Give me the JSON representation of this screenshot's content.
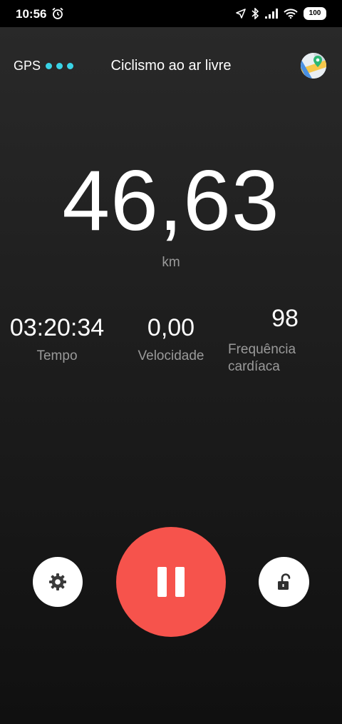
{
  "status_bar": {
    "time": "10:56",
    "battery": "100"
  },
  "header": {
    "gps_label": "GPS",
    "title": "Ciclismo ao ar livre"
  },
  "distance": {
    "value": "46,63",
    "unit": "km"
  },
  "stats": [
    {
      "value": "03:20:34",
      "label": "Tempo"
    },
    {
      "value": "0,00",
      "label": "Velocidade"
    },
    {
      "value": "98",
      "label": "Frequência cardíaca"
    }
  ],
  "colors": {
    "accent": "#39d3e6",
    "pause_button": "#f6534c",
    "muted_text": "#9a9a9a"
  },
  "icons": [
    "alarm-icon",
    "location-arrow-icon",
    "bluetooth-icon",
    "signal-icon",
    "wifi-icon",
    "map-icon",
    "gear-icon",
    "pause-icon",
    "unlock-icon"
  ]
}
